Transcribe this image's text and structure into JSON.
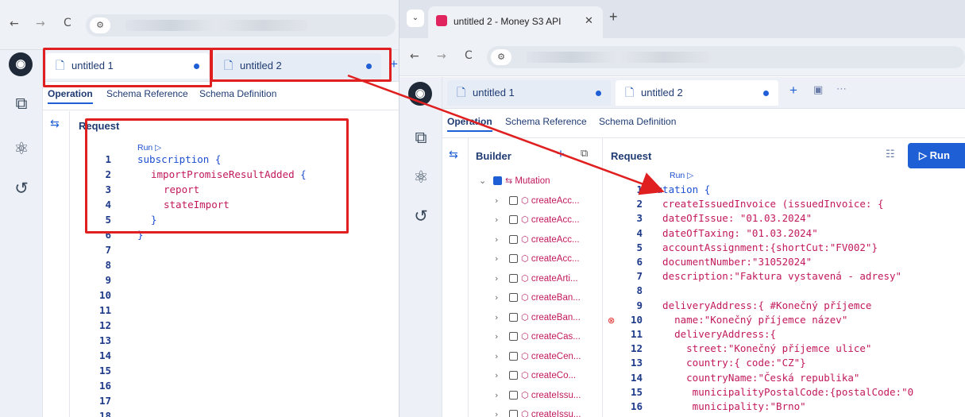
{
  "left": {
    "tabs": [
      {
        "label": "untitled 1"
      },
      {
        "label": "untitled 2"
      }
    ],
    "subtabs": [
      "Operation",
      "Schema Reference",
      "Schema Definition"
    ],
    "panel_title": "Request",
    "run_label": "Run ▷",
    "line_numbers": [
      "1",
      "2",
      "3",
      "4",
      "5",
      "6",
      "7",
      "8",
      "9",
      "10",
      "11",
      "12",
      "13",
      "14",
      "15",
      "16",
      "17",
      "18"
    ],
    "code": [
      {
        "kw": "subscription",
        "rest": " {"
      },
      {
        "fld": "importPromiseResultAdded",
        "rest": " {"
      },
      {
        "fld": "report"
      },
      {
        "fld": "stateImport"
      },
      {
        "rest": "}"
      },
      {
        "rest": "}"
      }
    ]
  },
  "right": {
    "window_tab_title": "untitled 2 - Money S3 API",
    "tabs": [
      {
        "label": "untitled 1"
      },
      {
        "label": "untitled 2"
      }
    ],
    "subtabs": [
      "Operation",
      "Schema Reference",
      "Schema Definition"
    ],
    "builder_title": "Builder",
    "request_title": "Request",
    "run_button": "Run",
    "run_label": "Run ▷",
    "mutation_label": "Mutation",
    "tree_items": [
      "createAcc...",
      "createAcc...",
      "createAcc...",
      "createAcc...",
      "createArti...",
      "createBan...",
      "createBan...",
      "createCas...",
      "createCen...",
      "createCo...",
      "createIssu...",
      "createIssu..."
    ],
    "line_numbers": [
      "1",
      "2",
      "3",
      "4",
      "5",
      "6",
      "7",
      "8",
      "9",
      "10",
      "11",
      "12",
      "13",
      "14",
      "15",
      "16"
    ],
    "code": [
      "mutation {",
      "  createIssuedInvoice (issuedInvoice: {",
      "  dateOfIssue: \"01.03.2024\"",
      "  dateOfTaxing: \"01.03.2024\"",
      "  accountAssignment:{shortCut:\"FV002\"}",
      "  documentNumber:\"31052024\"",
      "  description:\"Faktura vystavená - adresy\"",
      "",
      "  deliveryAddress:{ #Konečný příjemce",
      "    name:\"Konečný příjemce název\"",
      "    deliveryAddress:{",
      "      street:\"Konečný příjemce ulice\"",
      "      country:{ code:\"CZ\"}",
      "      countryName:\"Česká republika\"",
      "       municipalityPostalCode:{postalCode:\"0",
      "       municipality:\"Brno\""
    ]
  },
  "colors": {
    "accent": "#1f5fd6",
    "annotation": "#e02020",
    "field": "#c2185b"
  }
}
